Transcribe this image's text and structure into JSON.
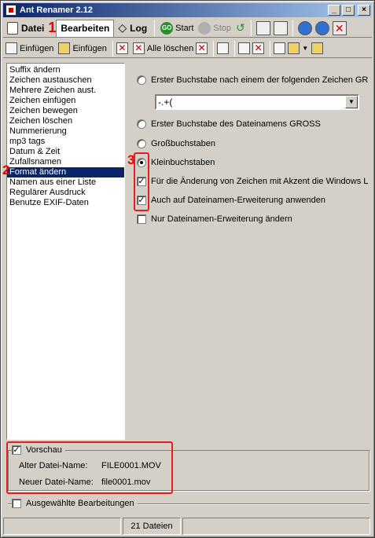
{
  "window": {
    "title": "Ant Renamer 2.12"
  },
  "tabs": [
    {
      "label": "Datei"
    },
    {
      "label": "Bearbeiten"
    },
    {
      "label": "Log"
    }
  ],
  "tools": {
    "start": "Start",
    "stop": "Stop"
  },
  "toolbar2": {
    "paste1": "Einfügen",
    "paste2": "Einfügen",
    "delete_all": "Alle löschen"
  },
  "actions": [
    "Suffix ändern",
    "Zeichen austauschen",
    "Mehrere Zeichen aust.",
    "Zeichen einfügen",
    "Zeichen bewegen",
    "Zeichen löschen",
    "Nummerierung",
    "mp3 tags",
    "Datum & Zeit",
    "Zufallsnamen",
    "Format ändern",
    "Namen aus einer Liste",
    "Regulärer Ausdruck",
    "Benutze EXIF-Daten"
  ],
  "selected_action": "Format ändern",
  "options": {
    "first_after_chars": "Erster Buchstabe nach einem der folgenden Zeichen GR",
    "chars_value": " -.+(",
    "first_of_filename": "Erster Buchstabe des Dateinamens GROSS",
    "uppercase": "Großbuchstaben",
    "lowercase": "Kleinbuchstaben",
    "accent": "Für die Änderung von Zeichen mit Akzent die Windows L",
    "apply_extension": "Auch auf Dateinamen-Erweiterung anwenden",
    "only_extension": "Nur Dateinamen-Erweiterung ändern"
  },
  "annotations": {
    "one": "1",
    "two": "2",
    "three": "3"
  },
  "preview": {
    "label": "Vorschau",
    "old_label": "Alter Datei-Name:",
    "old_value": "FILE0001.MOV",
    "new_label": "Neuer Datei-Name:",
    "new_value": "file0001.mov"
  },
  "selected_edits": {
    "label": "Ausgewählte Bearbeitungen"
  },
  "status": {
    "files": "21 Dateien"
  },
  "colors": {
    "title_start": "#0a246a",
    "title_end": "#a6caf0",
    "highlight": "#e02020",
    "selection": "#0a246a"
  }
}
